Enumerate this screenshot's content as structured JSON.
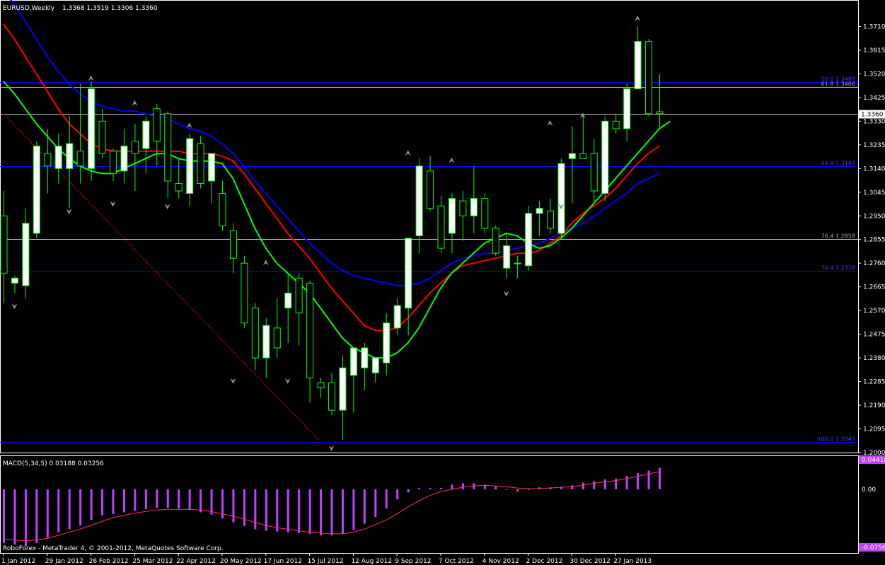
{
  "header": {
    "symbol": "EURUSD,Weekly",
    "ohlc": "1.3368 1.3519 1.3306 1.3360"
  },
  "footer": {
    "copyright": "RoboForex - MetaTrader 4, © 2001-2012, MetaQuotes Software Corp."
  },
  "colors": {
    "background": "#000000",
    "grid": "#ffffff",
    "bull_candle": "#ffffff",
    "bear_candle": "#000000",
    "wick": "#00ff00",
    "ma_fast": "#00ff00",
    "ma_mid": "#ff0000",
    "ma_slow": "#0000ff",
    "fib_line": "#0000ff",
    "fib_grey": "#c0c0c0",
    "macd_hist": "#c040ff",
    "macd_signal": "#ff3060",
    "trendline": "#ff0000",
    "current_price": "#c0c0c0"
  },
  "chart_data": [
    {
      "type": "candlestick",
      "title": "EURUSD,Weekly",
      "ylim": [
        1.2,
        1.3805
      ],
      "y_ticks": [
        "1.3710",
        "1.3615",
        "1.3520",
        "1.3425",
        "1.3330",
        "1.3235",
        "1.3140",
        "1.3045",
        "1.2950",
        "1.2855",
        "1.2760",
        "1.2665",
        "1.2570",
        "1.2475",
        "1.2380",
        "1.2285",
        "1.2190",
        "1.2095",
        "1.2000"
      ],
      "current_price_label": "1.3360",
      "current_price": 1.336,
      "x_ticks": [
        {
          "label": "1 Jan 2012",
          "bar": 0
        },
        {
          "label": "29 Jan 2012",
          "bar": 4
        },
        {
          "label": "26 Feb 2012",
          "bar": 8
        },
        {
          "label": "25 Mar 2012",
          "bar": 12
        },
        {
          "label": "22 Apr 2012",
          "bar": 16
        },
        {
          "label": "20 May 2012",
          "bar": 20
        },
        {
          "label": "17 Jun 2012",
          "bar": 24
        },
        {
          "label": "15 Jul 2012",
          "bar": 28
        },
        {
          "label": "12 Aug 2012",
          "bar": 32
        },
        {
          "label": "9 Sep 2012",
          "bar": 36
        },
        {
          "label": "7 Oct 2012",
          "bar": 40
        },
        {
          "label": "4 Nov 2012",
          "bar": 44
        },
        {
          "label": "2 Dec 2012",
          "bar": 48
        },
        {
          "label": "30 Dec 2012",
          "bar": 52
        },
        {
          "label": "27 Jan 2013",
          "bar": 56
        }
      ],
      "candles": [
        [
          1.295,
          1.305,
          1.26,
          1.272
        ],
        [
          1.268,
          1.271,
          1.264,
          1.27
        ],
        [
          1.267,
          1.298,
          1.262,
          1.292
        ],
        [
          1.288,
          1.325,
          1.286,
          1.323
        ],
        [
          1.32,
          1.33,
          1.304,
          1.315
        ],
        [
          1.314,
          1.328,
          1.308,
          1.323
        ],
        [
          1.314,
          1.335,
          1.298,
          1.324
        ],
        [
          1.321,
          1.348,
          1.308,
          1.315
        ],
        [
          1.314,
          1.349,
          1.309,
          1.346
        ],
        [
          1.333,
          1.338,
          1.318,
          1.32
        ],
        [
          1.321,
          1.322,
          1.309,
          1.312
        ],
        [
          1.313,
          1.33,
          1.308,
          1.323
        ],
        [
          1.325,
          1.332,
          1.305,
          1.32
        ],
        [
          1.322,
          1.335,
          1.312,
          1.333
        ],
        [
          1.338,
          1.34,
          1.315,
          1.325
        ],
        [
          1.336,
          1.337,
          1.302,
          1.309
        ],
        [
          1.308,
          1.318,
          1.302,
          1.305
        ],
        [
          1.304,
          1.328,
          1.299,
          1.326
        ],
        [
          1.324,
          1.327,
          1.306,
          1.308
        ],
        [
          1.309,
          1.32,
          1.3,
          1.32
        ],
        [
          1.304,
          1.309,
          1.289,
          1.291
        ],
        [
          1.289,
          1.292,
          1.272,
          1.278
        ],
        [
          1.276,
          1.279,
          1.25,
          1.252
        ],
        [
          1.258,
          1.26,
          1.233,
          1.238
        ],
        [
          1.238,
          1.254,
          1.23,
          1.251
        ],
        [
          1.25,
          1.262,
          1.238,
          1.242
        ],
        [
          1.258,
          1.272,
          1.244,
          1.264
        ],
        [
          1.27,
          1.272,
          1.243,
          1.256
        ],
        [
          1.268,
          1.269,
          1.22,
          1.23
        ],
        [
          1.228,
          1.23,
          1.222,
          1.226
        ],
        [
          1.228,
          1.232,
          1.215,
          1.217
        ],
        [
          1.217,
          1.239,
          1.205,
          1.234
        ],
        [
          1.231,
          1.241,
          1.216,
          1.242
        ],
        [
          1.234,
          1.244,
          1.225,
          1.242
        ],
        [
          1.232,
          1.238,
          1.228,
          1.238
        ],
        [
          1.236,
          1.256,
          1.231,
          1.252
        ],
        [
          1.25,
          1.262,
          1.247,
          1.259
        ],
        [
          1.258,
          1.272,
          1.247,
          1.286
        ],
        [
          1.287,
          1.318,
          1.28,
          1.315
        ],
        [
          1.313,
          1.319,
          1.297,
          1.298
        ],
        [
          1.299,
          1.303,
          1.28,
          1.282
        ],
        [
          1.288,
          1.304,
          1.28,
          1.302
        ],
        [
          1.301,
          1.305,
          1.285,
          1.295
        ],
        [
          1.295,
          1.315,
          1.288,
          1.302
        ],
        [
          1.302,
          1.304,
          1.288,
          1.29
        ],
        [
          1.29,
          1.291,
          1.279,
          1.28
        ],
        [
          1.274,
          1.288,
          1.27,
          1.283
        ],
        [
          1.276,
          1.279,
          1.27,
          1.276
        ],
        [
          1.275,
          1.299,
          1.273,
          1.296
        ],
        [
          1.296,
          1.301,
          1.287,
          1.298
        ],
        [
          1.297,
          1.302,
          1.288,
          1.29
        ],
        [
          1.288,
          1.318,
          1.286,
          1.316
        ],
        [
          1.318,
          1.331,
          1.3,
          1.32
        ],
        [
          1.32,
          1.335,
          1.319,
          1.318
        ],
        [
          1.32,
          1.326,
          1.3,
          1.305
        ],
        [
          1.304,
          1.335,
          1.301,
          1.333
        ],
        [
          1.333,
          1.336,
          1.328,
          1.33
        ],
        [
          1.33,
          1.348,
          1.325,
          1.346
        ],
        [
          1.346,
          1.371,
          1.346,
          1.365
        ],
        [
          1.365,
          1.366,
          1.335,
          1.336
        ],
        [
          1.3368,
          1.3519,
          1.3306,
          1.336
        ]
      ],
      "ma_fast": [
        1.349,
        1.344,
        1.338,
        1.332,
        1.327,
        1.322,
        1.318,
        1.315,
        1.313,
        1.312,
        1.312,
        1.314,
        1.316,
        1.318,
        1.32,
        1.32,
        1.318,
        1.317,
        1.317,
        1.317,
        1.316,
        1.31,
        1.3,
        1.29,
        1.282,
        1.276,
        1.272,
        1.268,
        1.264,
        1.258,
        1.252,
        1.246,
        1.242,
        1.24,
        1.238,
        1.238,
        1.24,
        1.244,
        1.25,
        1.258,
        1.266,
        1.272,
        1.276,
        1.28,
        1.284,
        1.286,
        1.288,
        1.287,
        1.284,
        1.282,
        1.283,
        1.286,
        1.29,
        1.295,
        1.3,
        1.305,
        1.31,
        1.315,
        1.32,
        1.325,
        1.33,
        1.333
      ],
      "ma_mid": [
        1.372,
        1.366,
        1.359,
        1.352,
        1.345,
        1.338,
        1.332,
        1.328,
        1.324,
        1.322,
        1.321,
        1.321,
        1.321,
        1.321,
        1.321,
        1.321,
        1.321,
        1.32,
        1.32,
        1.32,
        1.319,
        1.317,
        1.312,
        1.306,
        1.3,
        1.294,
        1.288,
        1.283,
        1.278,
        1.272,
        1.266,
        1.261,
        1.256,
        1.251,
        1.249,
        1.249,
        1.25,
        1.254,
        1.259,
        1.264,
        1.268,
        1.272,
        1.275,
        1.276,
        1.277,
        1.278,
        1.279,
        1.28,
        1.28,
        1.281,
        1.284,
        1.287,
        1.292,
        1.296,
        1.299,
        1.302,
        1.306,
        1.311,
        1.316,
        1.32,
        1.323
      ],
      "ma_slow": [
        1.385,
        1.38,
        1.373,
        1.366,
        1.359,
        1.353,
        1.348,
        1.344,
        1.341,
        1.339,
        1.338,
        1.337,
        1.337,
        1.336,
        1.335,
        1.334,
        1.332,
        1.33,
        1.329,
        1.327,
        1.324,
        1.32,
        1.315,
        1.309,
        1.304,
        1.299,
        1.294,
        1.289,
        1.284,
        1.28,
        1.276,
        1.273,
        1.271,
        1.27,
        1.269,
        1.268,
        1.267,
        1.267,
        1.268,
        1.27,
        1.273,
        1.276,
        1.278,
        1.279,
        1.28,
        1.28,
        1.281,
        1.282,
        1.283,
        1.284,
        1.286,
        1.288,
        1.29,
        1.292,
        1.295,
        1.298,
        1.301,
        1.304,
        1.308,
        1.31,
        1.312
      ],
      "fib_levels": [
        {
          "label": "50.0 1.3488",
          "price": 1.3488,
          "color": "#0000ff"
        },
        {
          "label": "61.8 1.3466",
          "price": 1.3466,
          "color": "#c0c0c0"
        },
        {
          "label": "61.8 1.3148",
          "price": 1.3148,
          "color": "#0000ff"
        },
        {
          "label": "76.4 1.2858",
          "price": 1.2858,
          "color": "#c0c0c0"
        },
        {
          "label": "76.4 1.2728",
          "price": 1.2728,
          "color": "#0000ff"
        },
        {
          "label": "100.0 1.2043",
          "price": 1.2043,
          "color": "#0000ff"
        }
      ],
      "fractals_up": [
        [
          8,
          1.35
        ],
        [
          12,
          1.34
        ],
        [
          17,
          1.331
        ],
        [
          24,
          1.276
        ],
        [
          37,
          1.32
        ],
        [
          41,
          1.317
        ],
        [
          50,
          1.332
        ],
        [
          53,
          1.335
        ],
        [
          58,
          1.374
        ]
      ],
      "fractals_down": [
        [
          1,
          1.259
        ],
        [
          6,
          1.297
        ],
        [
          10,
          1.3
        ],
        [
          15,
          1.299
        ],
        [
          21,
          1.229
        ],
        [
          26,
          1.229
        ],
        [
          30,
          1.202
        ],
        [
          46,
          1.264
        ],
        [
          51,
          1.299
        ]
      ],
      "trendline": [
        [
          0,
          1.336
        ],
        [
          29,
          1.2043
        ]
      ]
    },
    {
      "type": "bar",
      "title": "MACD(5,34,5) 0.03188 0.03256",
      "ylim": [
        -0.07563,
        0.04418
      ],
      "y_ticks": [
        "0.04418",
        "0.00",
        "-0.07563"
      ],
      "histogram": [
        -0.07,
        -0.072,
        -0.074,
        -0.07,
        -0.063,
        -0.056,
        -0.052,
        -0.047,
        -0.04,
        -0.034,
        -0.032,
        -0.03,
        -0.028,
        -0.026,
        -0.024,
        -0.024,
        -0.025,
        -0.027,
        -0.03,
        -0.033,
        -0.038,
        -0.043,
        -0.048,
        -0.052,
        -0.054,
        -0.055,
        -0.056,
        -0.057,
        -0.058,
        -0.06,
        -0.06,
        -0.058,
        -0.053,
        -0.045,
        -0.036,
        -0.025,
        -0.013,
        -0.004,
        0.002,
        0.002,
        0.002,
        0.007,
        0.009,
        0.009,
        0.007,
        0.004,
        0.0,
        -0.003,
        0.0,
        0.003,
        0.003,
        0.004,
        0.006,
        0.01,
        0.012,
        0.015,
        0.016,
        0.02,
        0.024,
        0.028,
        0.032
      ],
      "signal": [
        -0.065,
        -0.066,
        -0.067,
        -0.066,
        -0.064,
        -0.06,
        -0.056,
        -0.052,
        -0.047,
        -0.042,
        -0.037,
        -0.034,
        -0.031,
        -0.029,
        -0.027,
        -0.026,
        -0.026,
        -0.026,
        -0.027,
        -0.029,
        -0.032,
        -0.035,
        -0.039,
        -0.043,
        -0.047,
        -0.05,
        -0.052,
        -0.054,
        -0.056,
        -0.057,
        -0.058,
        -0.058,
        -0.056,
        -0.052,
        -0.046,
        -0.04,
        -0.032,
        -0.023,
        -0.015,
        -0.008,
        -0.003,
        0.0,
        0.003,
        0.005,
        0.006,
        0.005,
        0.004,
        0.002,
        0.001,
        0.001,
        0.002,
        0.003,
        0.004,
        0.006,
        0.009,
        0.011,
        0.013,
        0.016,
        0.019,
        0.023,
        0.026
      ]
    }
  ]
}
